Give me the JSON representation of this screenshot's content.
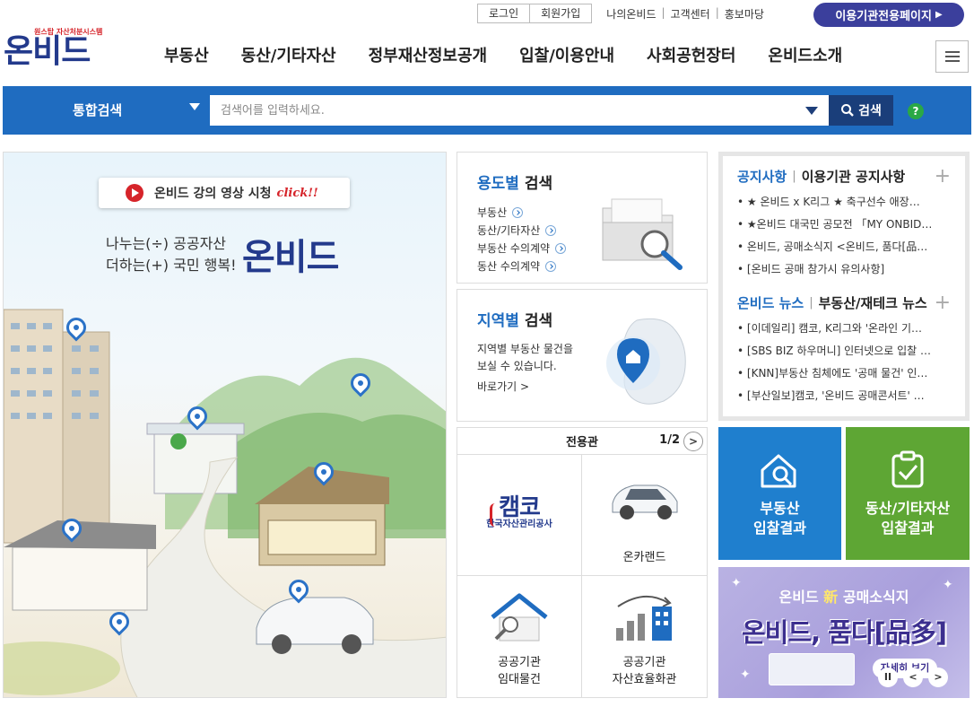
{
  "util": {
    "login": "로그인",
    "signup": "회원가입",
    "links": [
      "나의온비드",
      "고객센터",
      "홍보마당"
    ],
    "partner_page": "이용기관전용페이지"
  },
  "logo": {
    "subtitle": "원스탑 자산처분시스템",
    "name": "온비드"
  },
  "gnb": [
    "부동산",
    "동산/기타자산",
    "정부재산정보공개",
    "입찰/이용안내",
    "사회공헌장터",
    "온비드소개"
  ],
  "search": {
    "scope": "통합검색",
    "placeholder": "검색어를 입력하세요.",
    "button": "검색",
    "help": "?"
  },
  "hero": {
    "video_label": "온비드 강의 영상 시청",
    "click_text": "click!!",
    "slogan_1": "나누는(÷) 공공자산",
    "slogan_2": "더하는(+) 국민 행복!",
    "logo_text": "온비드"
  },
  "use_search": {
    "title_hl": "용도별",
    "title_rest": " 검색",
    "items": [
      "부동산",
      "동산/기타자산",
      "부동산 수의계약",
      "동산 수의계약"
    ]
  },
  "region_search": {
    "title_hl": "지역별",
    "title_rest": " 검색",
    "desc_1": "지역별 부동산 물건을",
    "desc_2": "보실 수 있습니다.",
    "go": "바로가기 >"
  },
  "dedicated": {
    "title": "전용관",
    "page": "1/2",
    "next": ">",
    "items": [
      {
        "name": "캠코",
        "sub": "한국자산관리공사"
      },
      {
        "label": "온카랜드"
      },
      {
        "label_1": "공공기관",
        "label_2": "임대물건"
      },
      {
        "label_1": "공공기관",
        "label_2": "자산효율화관"
      }
    ]
  },
  "notice": {
    "tab_active": "공지사항",
    "tab_other": "이용기관 공지사항",
    "plus": "+",
    "items": [
      "• ★ 온비드 x K리그 ★ 축구선수 애장…",
      "• ★온비드 대국민 공모전 「MY ONBID…",
      "• 온비드, 공매소식지 <온비드, 품다[品…",
      "• [온비드 공매 참가시 유의사항]"
    ]
  },
  "news": {
    "tab_active": "온비드 뉴스",
    "tab_other": "부동산/재테크 뉴스",
    "plus": "+",
    "items": [
      "• [이데일리] 캠코, K리그와 '온라인 기…",
      "• [SBS BIZ 하우머니] 인터넷으로 입찰 …",
      "• [KNN]부동산 침체에도 '공매 물건' 인…",
      "• [부산일보]캠코, '온비드 공매콘서트' …"
    ]
  },
  "tiles": {
    "realestate_1": "부동산",
    "realestate_2": "입찰결과",
    "movable_1": "동산/기타자산",
    "movable_2": "입찰결과"
  },
  "banner": {
    "line1_a": "온비드 ",
    "line1_b": "新",
    "line1_c": " 공매소식지",
    "line2": "온비드, 품다[品多]",
    "button": "자세히 보기",
    "pause": "II",
    "prev": "<",
    "next": ">"
  },
  "colors": {
    "primary_blue": "#1f6cc0",
    "navy": "#1a3e7a",
    "partner": "#3b3f9c",
    "tile_blue": "#1f7fce",
    "tile_green": "#5ea634"
  }
}
